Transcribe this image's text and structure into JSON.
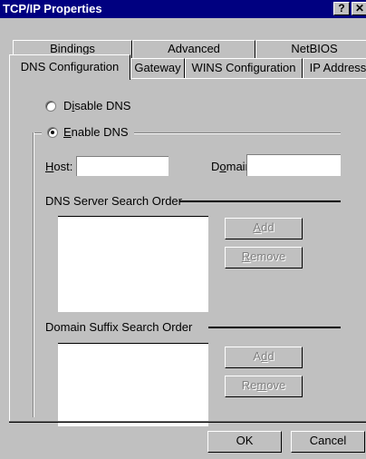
{
  "window": {
    "title": "TCP/IP Properties",
    "help_glyph": "?",
    "close_glyph": "✕"
  },
  "tabs": {
    "row1": [
      "Bindings",
      "Advanced",
      "NetBIOS"
    ],
    "row2": [
      "DNS Configuration",
      "Gateway",
      "WINS Configuration",
      "IP Address"
    ],
    "active": "DNS Configuration"
  },
  "dns": {
    "disable": {
      "pre": "D",
      "accel": "i",
      "post": "sable DNS",
      "selected": false
    },
    "enable": {
      "pre": "",
      "accel": "E",
      "post": "nable DNS",
      "selected": true
    },
    "host": {
      "pre": "",
      "accel": "H",
      "post": "ost:",
      "value": ""
    },
    "domain": {
      "pre": "D",
      "accel": "o",
      "post": "main:",
      "value": ""
    },
    "server_order": {
      "label": "DNS Server Search Order",
      "entries": []
    },
    "suffix_order": {
      "label": "Domain Suffix Search Order",
      "entries": []
    },
    "add1": {
      "pre": "",
      "accel": "A",
      "post": "dd",
      "enabled": false
    },
    "remove1": {
      "pre": "",
      "accel": "R",
      "post": "emove",
      "enabled": false
    },
    "add2": {
      "pre": "A",
      "accel": "d",
      "post": "d",
      "enabled": false
    },
    "remove2": {
      "pre": "Re",
      "accel": "m",
      "post": "ove",
      "enabled": false
    }
  },
  "footer": {
    "ok": "OK",
    "cancel": "Cancel"
  }
}
